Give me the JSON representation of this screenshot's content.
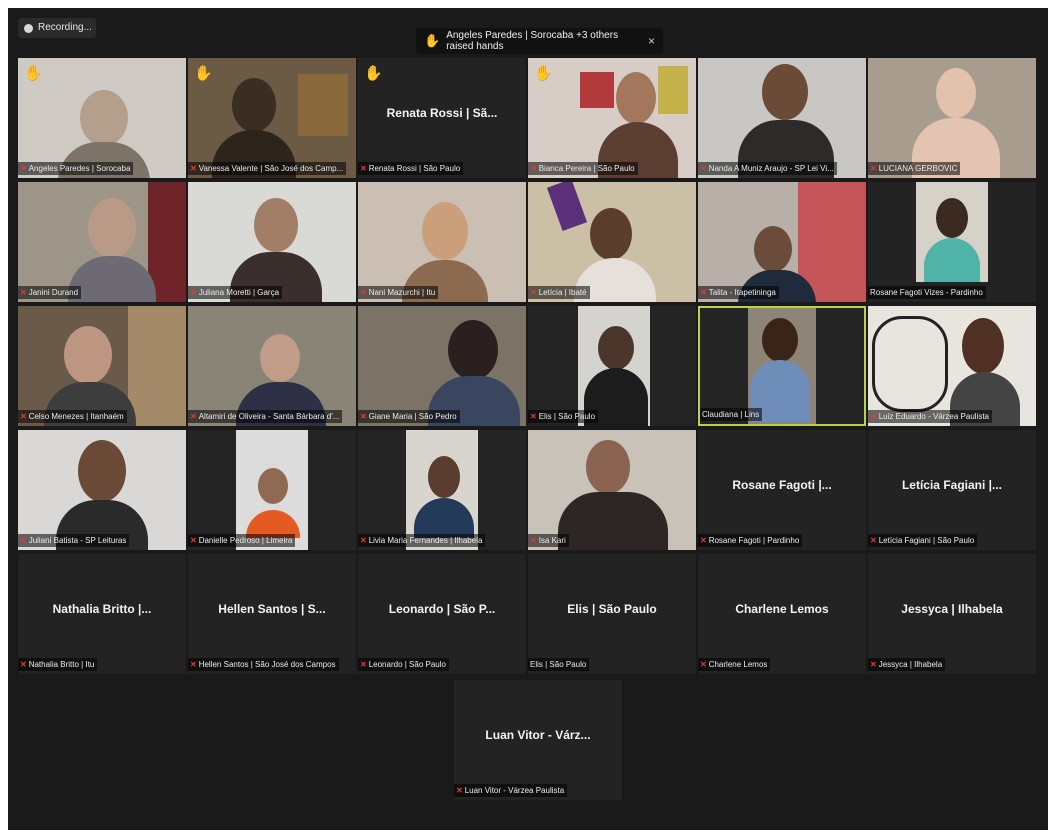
{
  "toolbar": {
    "recording_label": "Recording..."
  },
  "notification": {
    "text": "Angeles Paredes | Sorocaba +3 others raised hands",
    "close": "×"
  },
  "colors": {
    "raised_hand": "#f2c230",
    "mic_muted": "#e23a3a",
    "active_speaker_border": "#b9d24a"
  },
  "participants": [
    {
      "label": "Angeles Paredes | Sorocaba",
      "hand": true
    },
    {
      "label": "Vanessa Valente | São José dos Camp...",
      "hand": true
    },
    {
      "label": "Renata Rossi | São Paulo",
      "hand": true,
      "name_tile": "Renata Rossi | Sã..."
    },
    {
      "label": "Bianca Pereira | São Paulo",
      "hand": true
    },
    {
      "label": "Nanda A Muniz Araujo - SP Lei Vi...",
      "hand": false
    },
    {
      "label": "LUCIANA GERBOVIC",
      "hand": false
    },
    {
      "label": "Janini Durand",
      "hand": false
    },
    {
      "label": "Juliana Moretti | Garça",
      "hand": false
    },
    {
      "label": "Nani Mazurchi | Itu",
      "hand": false
    },
    {
      "label": "Letícia | Ibaté",
      "hand": false
    },
    {
      "label": "Talita - Itapetininga",
      "hand": false
    },
    {
      "label": "Rosane Fagoti Vizes - Pardinho",
      "hand": false
    },
    {
      "label": "Celso Menezes | Itanhaém",
      "hand": false
    },
    {
      "label": "Altamiri de Oliveira - Santa Bárbara d'...",
      "hand": false
    },
    {
      "label": "Giane Maria | São Pedro",
      "hand": false
    },
    {
      "label": "Elis | São Paulo",
      "hand": false
    },
    {
      "label": "Claudiana | Lins",
      "hand": false,
      "active": true
    },
    {
      "label": "Luiz Eduardo - Várzea Paulista",
      "hand": false
    },
    {
      "label": "Juliani Batista - SP Leituras",
      "hand": false
    },
    {
      "label": "Danielle Pedroso | Limeira",
      "hand": false
    },
    {
      "label": "Livia Maria Fernandes | Ilhabela",
      "hand": false
    },
    {
      "label": "Isa Kari",
      "hand": false
    },
    {
      "label": "Rosane Fagoti | Pardinho",
      "hand": false,
      "name_tile": "Rosane Fagoti |..."
    },
    {
      "label": "Letícia Fagiani | São Paulo",
      "hand": false,
      "name_tile": "Letícia Fagiani |..."
    },
    {
      "label": "Nathalia Britto | Itu",
      "hand": false,
      "name_tile": "Nathalia Britto |..."
    },
    {
      "label": "Hellen Santos | São José dos Campos",
      "hand": false,
      "name_tile": "Hellen Santos | S..."
    },
    {
      "label": "Leonardo | São Paulo",
      "hand": false,
      "name_tile": "Leonardo | São P..."
    },
    {
      "label": "Elis | São Paulo",
      "hand": false,
      "name_tile": "Elis | São Paulo",
      "unmuted": true
    },
    {
      "label": "Charlene Lemos",
      "hand": false,
      "name_tile": "Charlene Lemos"
    },
    {
      "label": "Jessyca | Ilhabela",
      "hand": false,
      "name_tile": "Jessyca | Ilhabela"
    },
    {
      "label": "Luan Vitor - Várzea Paulista",
      "hand": false,
      "name_tile": "Luan Vitor - Várz..."
    }
  ]
}
